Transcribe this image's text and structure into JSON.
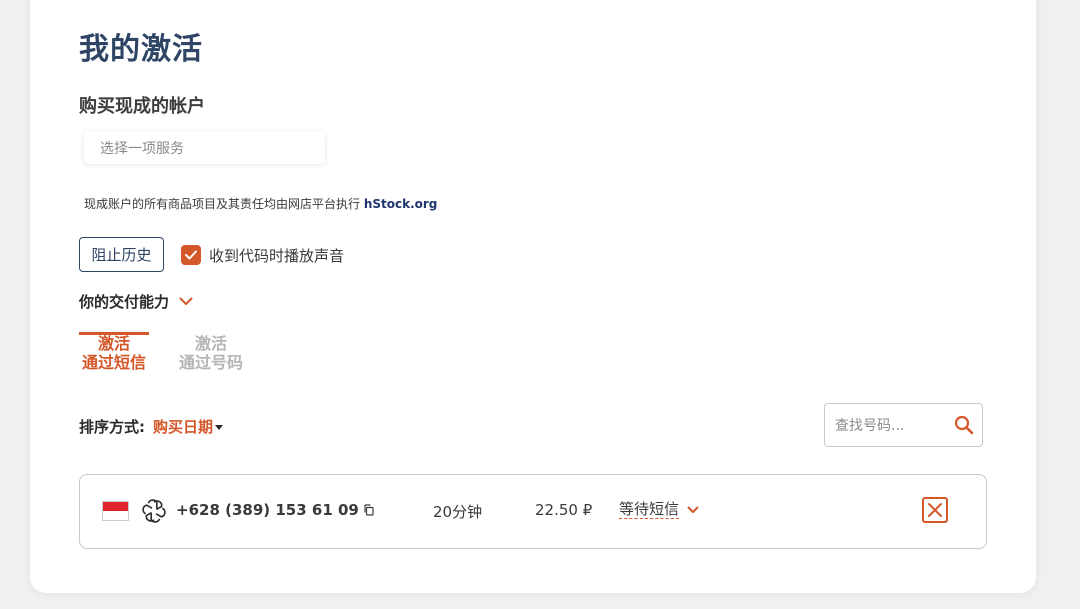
{
  "page": {
    "title": "我的激活",
    "section_title": "购买现成的帐户",
    "service_select_placeholder": "选择一项服务",
    "note_text": "现成账户的所有商品项目及其责任均由网店平台执行 ",
    "note_link": "hStock.org"
  },
  "controls": {
    "history_button": "阻止历史",
    "sound_checkbox": {
      "label": "收到代码时播放声音",
      "checked": true
    },
    "capacity_label": "你的交付能力"
  },
  "tabs": [
    {
      "line1": "激活",
      "line2": "通过短信",
      "active": true
    },
    {
      "line1": "激活",
      "line2": "通过号码",
      "active": false
    }
  ],
  "sort": {
    "label": "排序方式:",
    "value": "购买日期"
  },
  "search": {
    "placeholder": "查找号码..."
  },
  "orders": [
    {
      "country_flag": "indonesia-flag",
      "service_icon": "openai-icon",
      "phone": "+628 (389) 153 61 09",
      "duration": "20分钟",
      "price": "22.50 ₽",
      "status": "等待短信"
    }
  ],
  "colors": {
    "accent": "#d4572a",
    "title": "#2f4566",
    "link": "#1f3570"
  }
}
